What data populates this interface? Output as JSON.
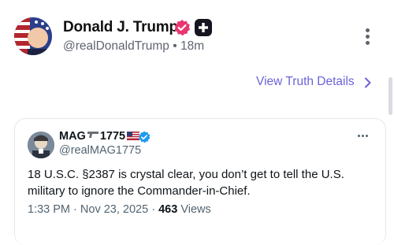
{
  "post": {
    "author_name": "Donald J. Trump",
    "author_handle": "@realDonaldTrump",
    "separator": "•",
    "time_ago": "18m",
    "details_link": "View Truth Details"
  },
  "embedded_tweet": {
    "name": "MAG🔫1775🇺🇸",
    "name_text": "MAG",
    "name_num": "1775",
    "handle": "@realMAG1775",
    "text": "18 U.S.C. §2387 is crystal clear, you don’t get to tell the U.S. military to ignore the Commander-in-Chief.",
    "time": "1:33 PM",
    "date": "Nov 23, 2025",
    "dot": "·",
    "views_count": "463",
    "views_label": "Views"
  },
  "colors": {
    "link": "#6c63d8",
    "verified_pink": "#e8366f",
    "twitter_blue": "#1d9bf0",
    "muted": "#5f6470"
  },
  "icons": {
    "verified": "verified-badge-icon",
    "plus": "plus-badge-icon",
    "more": "kebab-menu-icon",
    "chevron": "chevron-right-icon",
    "tweet_verified": "blue-check-icon",
    "tweet_more": "more-horizontal-icon",
    "gun": "pistol-emoji",
    "flag": "us-flag-emoji"
  }
}
